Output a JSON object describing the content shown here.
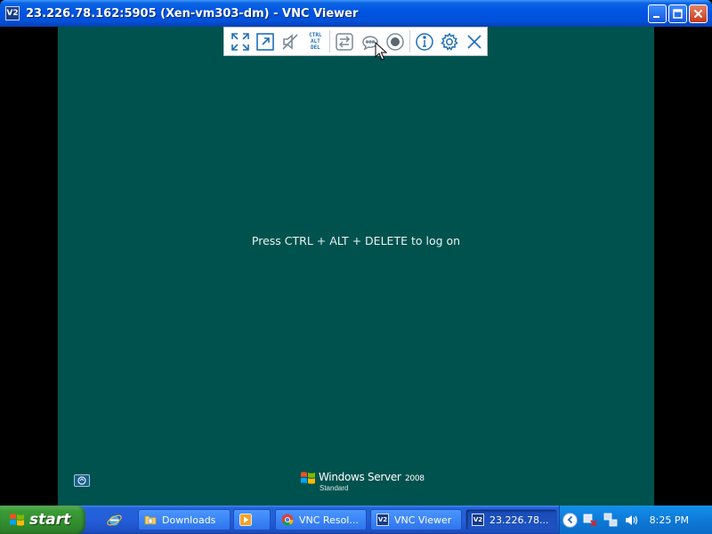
{
  "window": {
    "icon_label": "V2",
    "title": "23.226.78.162:5905 (Xen-vm303-dm) - VNC Viewer"
  },
  "remote": {
    "logon_message": "Press CTRL + ALT + DELETE to log on",
    "os_brand": "Windows Server",
    "os_year": "2008",
    "os_edition": "Standard",
    "background_color": "#00524e"
  },
  "vnc_toolbar": {
    "cad_line1": "CTRL",
    "cad_line2": "ALT",
    "cad_line3": "DEL",
    "accent_color": "#1e6fb8"
  },
  "taskbar": {
    "start_label": "start",
    "tasks": [
      {
        "label": "Downloads"
      },
      {
        "label": ""
      },
      {
        "label": "VNC Resol..."
      },
      {
        "label": "VNC Viewer"
      },
      {
        "label": "23.226.78..."
      }
    ],
    "vnc_icon_label": "V2",
    "clock": "8:25 PM"
  }
}
